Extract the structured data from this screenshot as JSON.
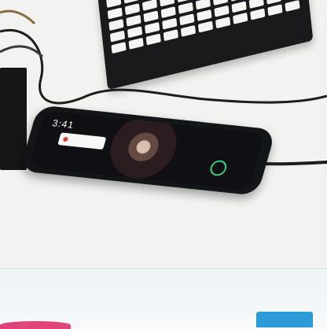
{
  "phone": {
    "clock": "3:41"
  },
  "colors": {
    "desk": "#f2f2f0",
    "phone_body": "#121619",
    "accent_blue": "#2d9ad8",
    "accent_pink": "#e0457a"
  }
}
